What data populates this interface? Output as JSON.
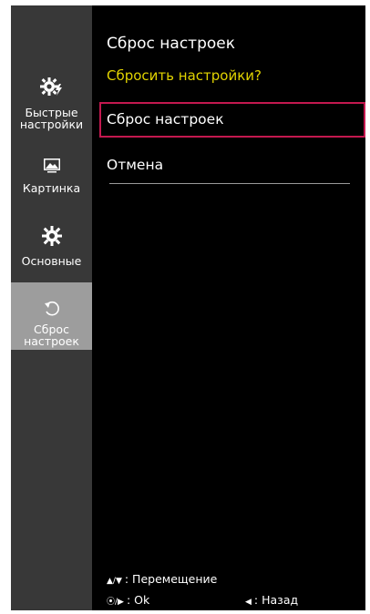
{
  "sidebar": {
    "items": [
      {
        "label_line1": "Быстрые",
        "label_line2": "настройки",
        "icon": "gear-lightning-icon"
      },
      {
        "label": "Картинка",
        "icon": "picture-icon"
      },
      {
        "label": "Основные",
        "icon": "gear-icon"
      },
      {
        "label_line1": "Сброс",
        "label_line2": "настроек",
        "icon": "reset-icon",
        "active": true
      }
    ]
  },
  "main": {
    "title": "Сброс настроек",
    "question": "Сбросить настройки?",
    "options": [
      {
        "label": "Сброс настроек",
        "selected": true
      },
      {
        "label": "Отмена",
        "selected": false
      }
    ]
  },
  "footer": {
    "move_icons": "▲/▼",
    "move_label": ": Перемещение",
    "ok_icons": "⦿/▶",
    "ok_label": ": Ok",
    "back_icon": "◀",
    "back_label": ": Назад"
  },
  "colors": {
    "sidebar_bg": "#383838",
    "active_bg": "#9d9d9d",
    "question": "#e1d300",
    "selection_border": "#c3184f"
  }
}
